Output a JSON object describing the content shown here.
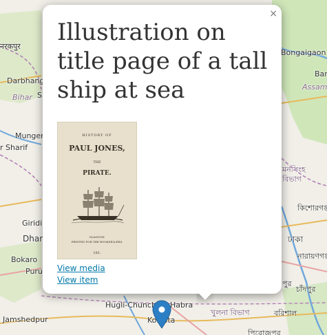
{
  "map": {
    "labels": [
      {
        "text": "Bongaigaon",
        "kind": "town"
      },
      {
        "text": "Barp",
        "kind": "town"
      },
      {
        "text": "Assam",
        "kind": "region"
      },
      {
        "text": "नरकपुर",
        "kind": "town"
      },
      {
        "text": "Darbhanga",
        "kind": "town"
      },
      {
        "text": "Bihar",
        "kind": "region"
      },
      {
        "text": "S",
        "kind": "town"
      },
      {
        "text": "Munger",
        "kind": "town"
      },
      {
        "text": "r Sharif",
        "kind": "town"
      },
      {
        "text": "মনসিংহ",
        "kind": "bengali"
      },
      {
        "text": "বিভাগ",
        "kind": "bengali"
      },
      {
        "text": "কিশোরগঞ্জ",
        "kind": "bengali"
      },
      {
        "text": "Giridih",
        "kind": "town"
      },
      {
        "text": "Dhan",
        "kind": "town"
      },
      {
        "text": "ঢাকা",
        "kind": "bengali"
      },
      {
        "text": "নারায়ণগঞ্জ",
        "kind": "bengali"
      },
      {
        "text": "Bokaro",
        "kind": "town"
      },
      {
        "text": "Purul",
        "kind": "town"
      },
      {
        "text": "পুর",
        "kind": "bengali"
      },
      {
        "text": "চাঁদপুর",
        "kind": "bengali"
      },
      {
        "text": "Hugli-Chunchura",
        "kind": "town"
      },
      {
        "text": "Habra",
        "kind": "town"
      },
      {
        "text": "খুলনা বিভাগ",
        "kind": "bengali"
      },
      {
        "text": "বরিশাল",
        "kind": "bengali"
      },
      {
        "text": "Jamshedpur",
        "kind": "town"
      },
      {
        "text": "Kolkata",
        "kind": "town"
      },
      {
        "text": "পিরোজপুর",
        "kind": "bengali"
      }
    ]
  },
  "popup": {
    "close_symbol": "×",
    "title": "Illustration on title page of a tall ship at sea",
    "thumbnail": {
      "lines": [
        "HISTORY OF",
        "PAUL JONES,",
        "THE",
        "PIRATE.",
        "GLASGOW:",
        "PRINTED FOR THE BOOKSELLERS.",
        "181."
      ]
    },
    "links": {
      "view_media": "View media",
      "view_item": "View item"
    }
  },
  "marker": {
    "icon": "map-marker-icon",
    "color": "#2c7fc4"
  }
}
